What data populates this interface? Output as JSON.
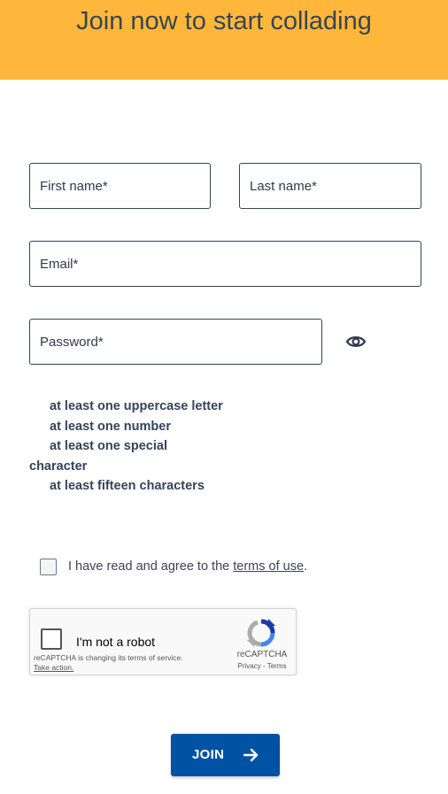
{
  "banner": {
    "title": "Join now to start collading",
    "color": "#ffb73b"
  },
  "form": {
    "first_name": {
      "placeholder": "First name*",
      "value": ""
    },
    "last_name": {
      "placeholder": "Last name*",
      "value": ""
    },
    "email": {
      "placeholder": "Email*",
      "value": ""
    },
    "password": {
      "placeholder": "Password*",
      "value": ""
    },
    "show_password_icon": "eye-icon"
  },
  "password_rules": [
    "at least one uppercase letter",
    "at least one number",
    "at least one special character",
    "at least fifteen characters"
  ],
  "terms": {
    "checked": false,
    "text_before": "I have read and agree to the ",
    "link_text": "terms of use",
    "text_after": "."
  },
  "recaptcha": {
    "label": "I'm not a robot",
    "notice": "reCAPTCHA is changing its terms of service.",
    "action": "Take action.",
    "brand": "reCAPTCHA",
    "privacy": "Privacy",
    "separator": " - ",
    "terms": "Terms",
    "icon": "recaptcha-logo-icon"
  },
  "join_button": {
    "label": "JOIN",
    "icon": "arrow-right-icon",
    "color": "#0052a5"
  }
}
